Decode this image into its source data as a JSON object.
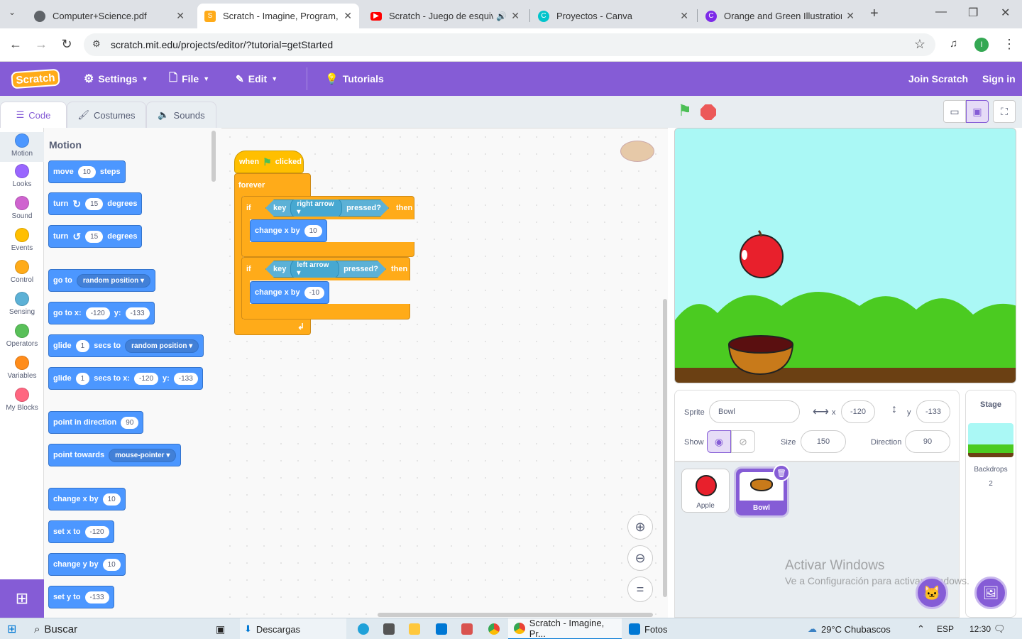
{
  "browser": {
    "tabs": [
      {
        "title": "Computer+Science.pdf",
        "icon": "globe-icon"
      },
      {
        "title": "Scratch - Imagine, Program, Sh",
        "icon": "scratch-icon"
      },
      {
        "title": "Scratch - Juego de esquiva",
        "icon": "youtube-icon"
      },
      {
        "title": "Proyectos - Canva",
        "icon": "canva-icon"
      },
      {
        "title": "Orange and Green Illustration C",
        "icon": "canva-icon"
      }
    ],
    "url": "scratch.mit.edu/projects/editor/?tutorial=getStarted",
    "profile_initial": "I"
  },
  "menubar": {
    "logo": "Scratch",
    "settings": "Settings",
    "file": "File",
    "edit": "Edit",
    "tutorials": "Tutorials",
    "join": "Join Scratch",
    "signin": "Sign in"
  },
  "editor_tabs": {
    "code": "Code",
    "costumes": "Costumes",
    "sounds": "Sounds"
  },
  "categories": [
    {
      "label": "Motion",
      "color": "#4c97ff"
    },
    {
      "label": "Looks",
      "color": "#9966ff"
    },
    {
      "label": "Sound",
      "color": "#cf63cf"
    },
    {
      "label": "Events",
      "color": "#ffbf00"
    },
    {
      "label": "Control",
      "color": "#ffab19"
    },
    {
      "label": "Sensing",
      "color": "#5cb1d6"
    },
    {
      "label": "Operators",
      "color": "#59c059"
    },
    {
      "label": "Variables",
      "color": "#ff8c1a"
    },
    {
      "label": "My Blocks",
      "color": "#ff6680"
    }
  ],
  "palette": {
    "heading": "Motion",
    "move": "move",
    "move_val": "10",
    "steps": "steps",
    "turn": "turn",
    "turn_val": "15",
    "degrees": "degrees",
    "goto": "go to",
    "random_position": "random position",
    "goto_x": "go to x:",
    "x_val": "-120",
    "y_label": "y:",
    "y_val": "-133",
    "glide": "glide",
    "glide_val": "1",
    "secs_to": "secs to",
    "secs_to_x": "secs to x:",
    "point_dir": "point in direction",
    "dir_val": "90",
    "point_towards": "point towards",
    "mouse_pointer": "mouse-pointer",
    "change_x": "change x by",
    "set_x": "set x to",
    "change_y": "change y by",
    "set_y": "set y to",
    "ten": "10"
  },
  "script": {
    "when": "when",
    "clicked": "clicked",
    "forever": "forever",
    "if": "if",
    "then": "then",
    "key": "key",
    "pressed": "pressed?",
    "right_arrow": "right arrow",
    "left_arrow": "left arrow",
    "change_x": "change x by",
    "val_right": "10",
    "val_left": "-10"
  },
  "sprite_info": {
    "sprite_label": "Sprite",
    "sprite_name": "Bowl",
    "x_label": "x",
    "x": "-120",
    "y_label": "y",
    "y": "-133",
    "show_label": "Show",
    "size_label": "Size",
    "size": "150",
    "direction_label": "Direction",
    "direction": "90"
  },
  "sprites": [
    {
      "name": "Apple"
    },
    {
      "name": "Bowl"
    }
  ],
  "stage_panel": {
    "title": "Stage",
    "backdrops_label": "Backdrops",
    "backdrops_count": "2"
  },
  "watermark": {
    "line1": "Activar Windows",
    "line2": "Ve a Configuración para activar Windows."
  },
  "taskbar": {
    "search": "Buscar",
    "downloads": "Descargas",
    "chrome_window": "Scratch - Imagine, Pr...",
    "photos": "Fotos",
    "weather": "29°C  Chubascos",
    "lang": "ESP",
    "time": "12:30"
  }
}
